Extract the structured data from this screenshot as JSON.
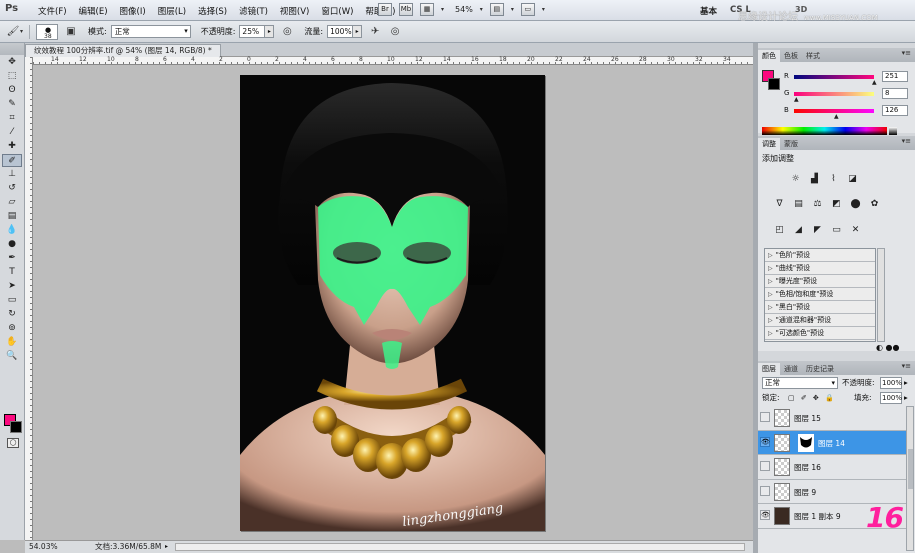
{
  "app": {
    "logo": "Ps",
    "menu": [
      "文件(F)",
      "编辑(E)",
      "图像(I)",
      "图层(L)",
      "选择(S)",
      "滤镜(T)",
      "视图(V)",
      "窗口(W)",
      "帮助(H)"
    ],
    "menu_tools": [
      "Br",
      "Mb"
    ],
    "zoom": "54%",
    "workspace": "基本",
    "cslive": "CS L",
    "threed": "3D",
    "watermark_text": "思缘设计论坛",
    "watermark_url": "www.MISSYUAN.COM"
  },
  "options": {
    "brush_size": "38",
    "mode_label": "模式:",
    "mode_value": "正常",
    "opacity_label": "不透明度:",
    "opacity_value": "25%",
    "flow_label": "流量:",
    "flow_value": "100%"
  },
  "document": {
    "tab_title": "纹效教程 100分辨率.tif @ 54% (图层 14, RGB/8) *"
  },
  "rulers": {
    "top": [
      "14",
      "12",
      "10",
      "8",
      "6",
      "4",
      "2",
      "0",
      "2",
      "4",
      "6",
      "8",
      "10",
      "12",
      "14",
      "16",
      "18",
      "20",
      "22",
      "24",
      "26",
      "28",
      "30",
      "32",
      "34"
    ]
  },
  "canvas": {
    "signature": "lingzhonggiang",
    "colors": {
      "hair": "#050505",
      "skin": "#e8c4b0",
      "paint": "#3cf58c",
      "gold": "#c8961c"
    }
  },
  "status": {
    "zoom": "54.03%",
    "doc": "文档:3.36M/65.8M"
  },
  "color_panel": {
    "tabs": [
      "颜色",
      "色板",
      "样式"
    ],
    "fg": "#fb087e",
    "bg": "#000000",
    "R_label": "R",
    "R": "251",
    "G_label": "G",
    "G": "8",
    "B_label": "B",
    "B": "126"
  },
  "adjust_panel": {
    "tabs": [
      "调整",
      "蒙版"
    ],
    "title": "添加调整",
    "presets": [
      "\"色阶\"预设",
      "\"曲线\"预设",
      "\"曝光度\"预设",
      "\"色相/饱和度\"预设",
      "\"黑白\"预设",
      "\"通道混和器\"预设",
      "\"可选颜色\"预设"
    ]
  },
  "layers_panel": {
    "tabs": [
      "图层",
      "通道",
      "历史记录"
    ],
    "blend_mode": "正常",
    "opacity_label": "不透明度:",
    "opacity": "100%",
    "lock_label": "锁定:",
    "fill_label": "填充:",
    "fill": "100%",
    "layers": [
      {
        "name": "图层 15",
        "visible": false,
        "selected": false
      },
      {
        "name": "图层 14",
        "visible": true,
        "selected": true
      },
      {
        "name": "图层 16",
        "visible": false,
        "selected": false
      },
      {
        "name": "图层 9",
        "visible": false,
        "selected": false
      },
      {
        "name": "图层 1 副本 9",
        "visible": true,
        "selected": false
      }
    ]
  },
  "step_number": "16"
}
